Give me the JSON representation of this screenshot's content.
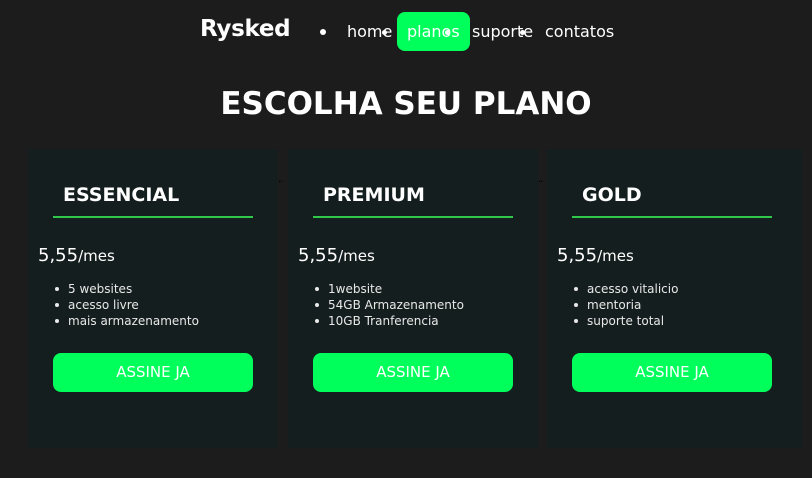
{
  "brand": {
    "name": "Rysked"
  },
  "nav": {
    "items": [
      {
        "label": "home"
      },
      {
        "label": "planos",
        "active": true
      },
      {
        "label": "suporte"
      },
      {
        "label": "contatos"
      }
    ]
  },
  "heading": "ESCOLHA SEU PLANO",
  "plans": [
    {
      "name": "ESSENCIAL",
      "price": "5,55",
      "period": "/mes",
      "features": [
        "5 websites",
        "acesso livre",
        "mais armazenamento"
      ],
      "cta": "ASSINE JA"
    },
    {
      "name": "PREMIUM",
      "price": "5,55",
      "period": "/mes",
      "features": [
        "1website",
        "54GB Armazenamento",
        "10GB Tranferencia"
      ],
      "cta": "ASSINE JA"
    },
    {
      "name": "GOLD",
      "price": "5,55",
      "period": "/mes",
      "features": [
        "acesso vitalicio",
        "mentoria",
        "suporte total"
      ],
      "cta": "ASSINE JA"
    }
  ],
  "colors": {
    "background": "#1c1c1c",
    "card": "#151e1e",
    "accent": "#00ff5a",
    "rule": "#2fc84a"
  }
}
